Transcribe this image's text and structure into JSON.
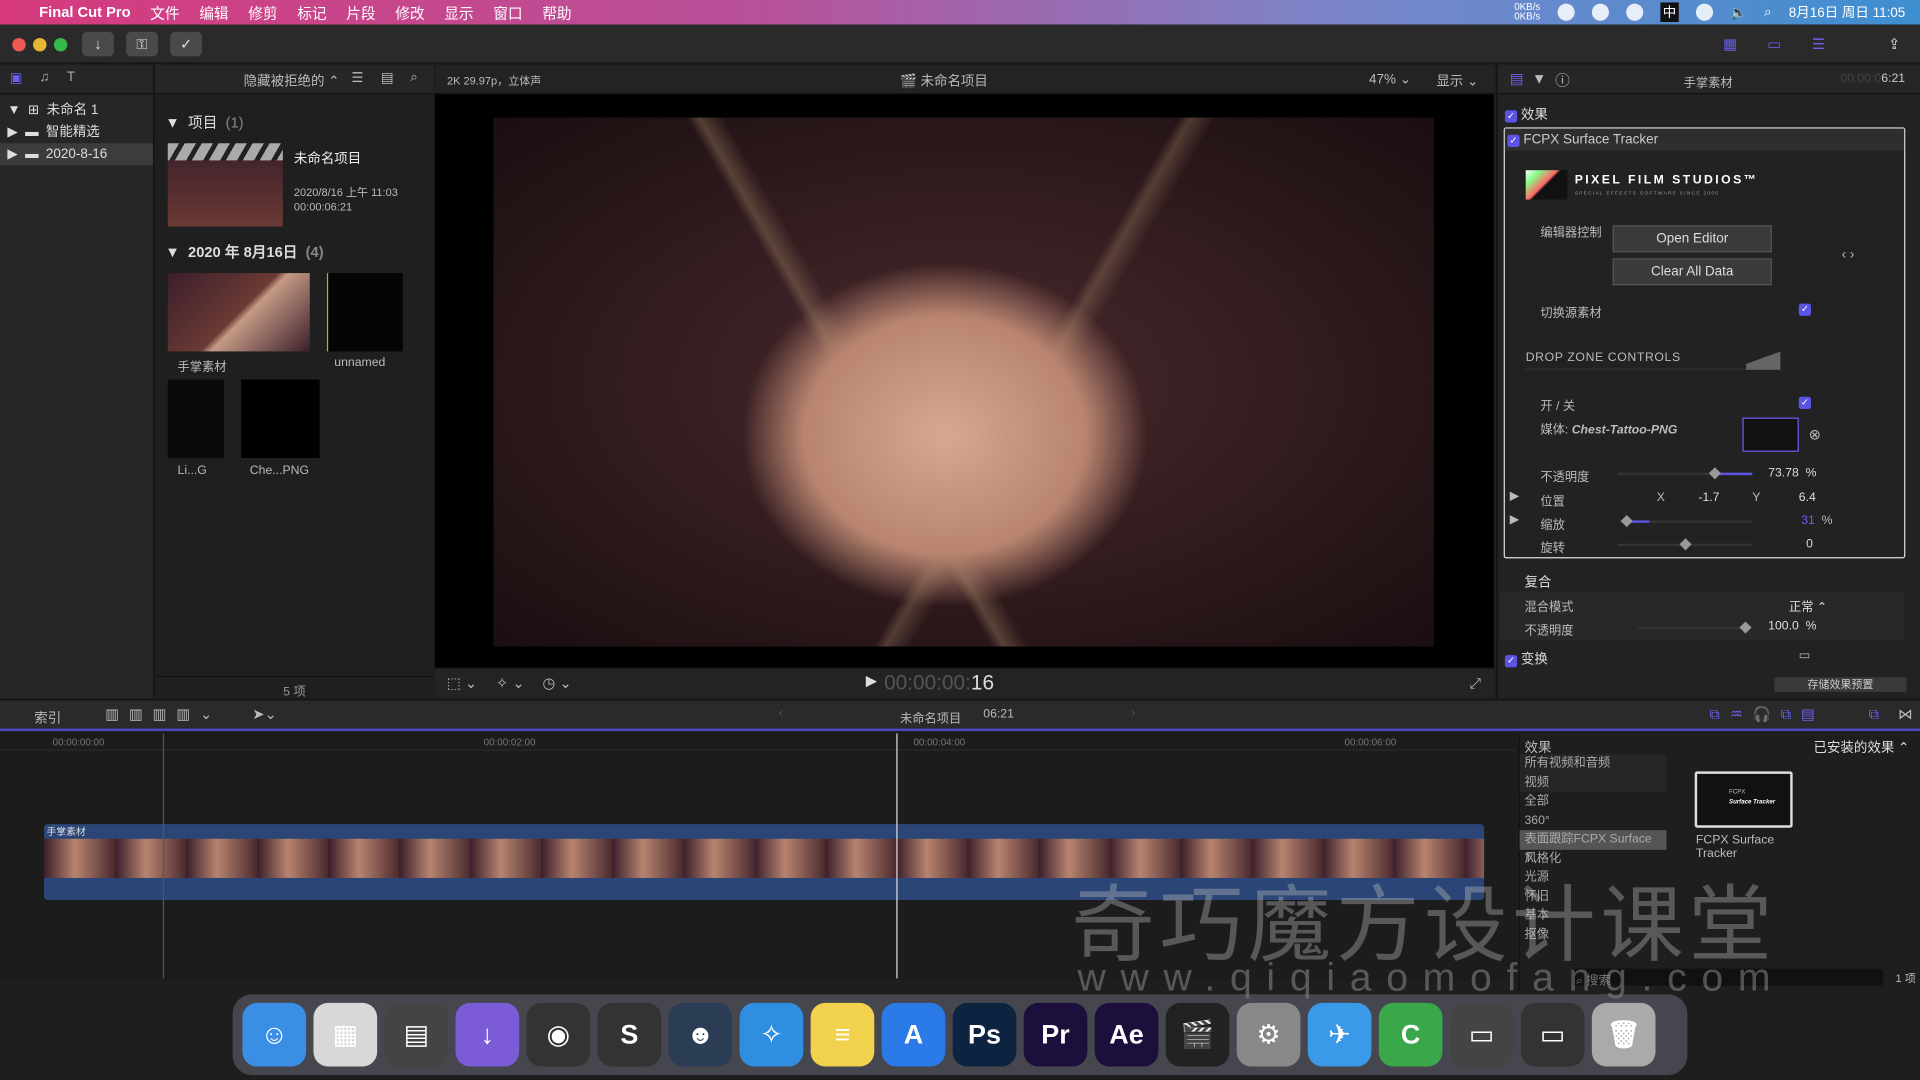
{
  "menubar": {
    "app": "Final Cut Pro",
    "items": [
      "文件",
      "编辑",
      "修剪",
      "标记",
      "片段",
      "修改",
      "显示",
      "窗口",
      "帮助"
    ],
    "net_up": "0KB/s",
    "net_down": "0KB/s",
    "ime": "中",
    "clock": "8月16日 周日 11:05"
  },
  "library": {
    "items": [
      {
        "label": "未命名 1",
        "icon": "library-icon"
      },
      {
        "label": "智能精选",
        "icon": "folder-icon"
      },
      {
        "label": "2020-8-16",
        "icon": "event-icon",
        "selected": true
      }
    ]
  },
  "browser": {
    "filter": "隐藏被拒绝的",
    "sections": [
      {
        "title": "项目",
        "count": "(1)"
      },
      {
        "title": "2020 年 8月16日",
        "count": "(4)"
      }
    ],
    "project": {
      "name": "未命名项目",
      "date": "2020/8/16 上午 11:03",
      "duration": "00:00:06:21"
    },
    "clips": [
      "手掌素材",
      "unnamed",
      "Li...G",
      "Che...PNG"
    ],
    "footer": "5 项"
  },
  "viewer": {
    "format": "2K 29.97p，立体声",
    "title": "未命名项目",
    "zoom": "47%",
    "display": "显示",
    "timecode_dim": "00:00:00:",
    "timecode": "16"
  },
  "inspector": {
    "clip": "手掌素材",
    "timecode_dim": "00:00:0",
    "timecode": "6:21",
    "effects_label": "效果",
    "effect_name": "FCPX Surface Tracker",
    "brand": "PIXEL FILM STUDIOS™",
    "brand_sub": "SPECIAL EFFECTS SOFTWARE SINCE 2005",
    "editor_ctrl": "编辑器控制",
    "open_editor": "Open Editor",
    "clear_data": "Clear All Data",
    "switch_source": "切换源素材",
    "drop_zone": "DROP ZONE CONTROLS",
    "onoff": "开 / 关",
    "media_label": "媒体:",
    "media_name": "Chest-Tattoo-PNG",
    "opacity_label": "不透明度",
    "opacity": "73.78",
    "pos_label": "位置",
    "pos_x_label": "X",
    "pos_x": "-1.7",
    "pos_y_label": "Y",
    "pos_y": "6.4",
    "scale_label": "缩放",
    "scale": "31",
    "rotate_label": "旋转",
    "rotate": "0",
    "pct": "%",
    "composite": "复合",
    "blend_label": "混合模式",
    "blend": "正常",
    "comp_opacity_label": "不透明度",
    "comp_opacity": "100.0",
    "transform": "变换",
    "save_preset": "存储效果预置"
  },
  "timeline": {
    "index": "索引",
    "project": "未命名项目",
    "duration": "06:21",
    "ruler": [
      "00:00:00:00",
      "00:00:02:00",
      "00:00:04:00",
      "00:00:06:00"
    ],
    "clip": "手掌素材"
  },
  "effects_browser": {
    "title": "效果",
    "installed": "已安装的效果",
    "categories": [
      "所有视频和音频",
      "视频",
      "全部",
      "360°",
      "表面跟踪FCPX Surface T...",
      "风格化",
      "光源",
      "怀旧",
      "基本",
      "抠像"
    ],
    "selected_index": 4,
    "item_name": "FCPX Surface Tracker",
    "thumb_line1": "FCPX",
    "thumb_line2": "Surface Tracker",
    "search_placeholder": "搜索",
    "count": "1 项"
  },
  "watermark": {
    "text": "奇巧魔方设计课堂",
    "url": "www.qiqiaomofang.com"
  },
  "dock": [
    {
      "name": "finder",
      "color": "#3a8ee6",
      "g": "☺"
    },
    {
      "name": "launchpad",
      "color": "#d8d8d8",
      "g": "▦"
    },
    {
      "name": "calculator",
      "color": "#444",
      "g": "▤"
    },
    {
      "name": "downie",
      "color": "#7b5cd6",
      "g": "↓"
    },
    {
      "name": "davinci",
      "color": "#333",
      "g": "◉"
    },
    {
      "name": "sublime",
      "color": "#333",
      "g": "S"
    },
    {
      "name": "cat",
      "color": "#2b3d55",
      "g": "☻"
    },
    {
      "name": "safari",
      "color": "#2f8ee0",
      "g": "✧"
    },
    {
      "name": "notes",
      "color": "#f2d24c",
      "g": "≡"
    },
    {
      "name": "app-store",
      "color": "#2a7ae8",
      "g": "A"
    },
    {
      "name": "photoshop",
      "color": "#0d2440",
      "g": "Ps"
    },
    {
      "name": "premiere",
      "color": "#1d0f3c",
      "g": "Pr"
    },
    {
      "name": "after-effects",
      "color": "#1d0f3c",
      "g": "Ae"
    },
    {
      "name": "final-cut-pro",
      "color": "#222",
      "g": "🎬"
    },
    {
      "name": "system-preferences",
      "color": "#888",
      "g": "⚙"
    },
    {
      "name": "airmail",
      "color": "#3a9ae8",
      "g": "✈"
    },
    {
      "name": "camtasia",
      "color": "#3aa84a",
      "g": "C"
    },
    {
      "name": "screenshot",
      "color": "#444",
      "g": "▭"
    },
    {
      "name": "fcp-window",
      "color": "#333",
      "g": "▭"
    },
    {
      "name": "trash",
      "color": "#aaa",
      "g": "🗑"
    }
  ]
}
